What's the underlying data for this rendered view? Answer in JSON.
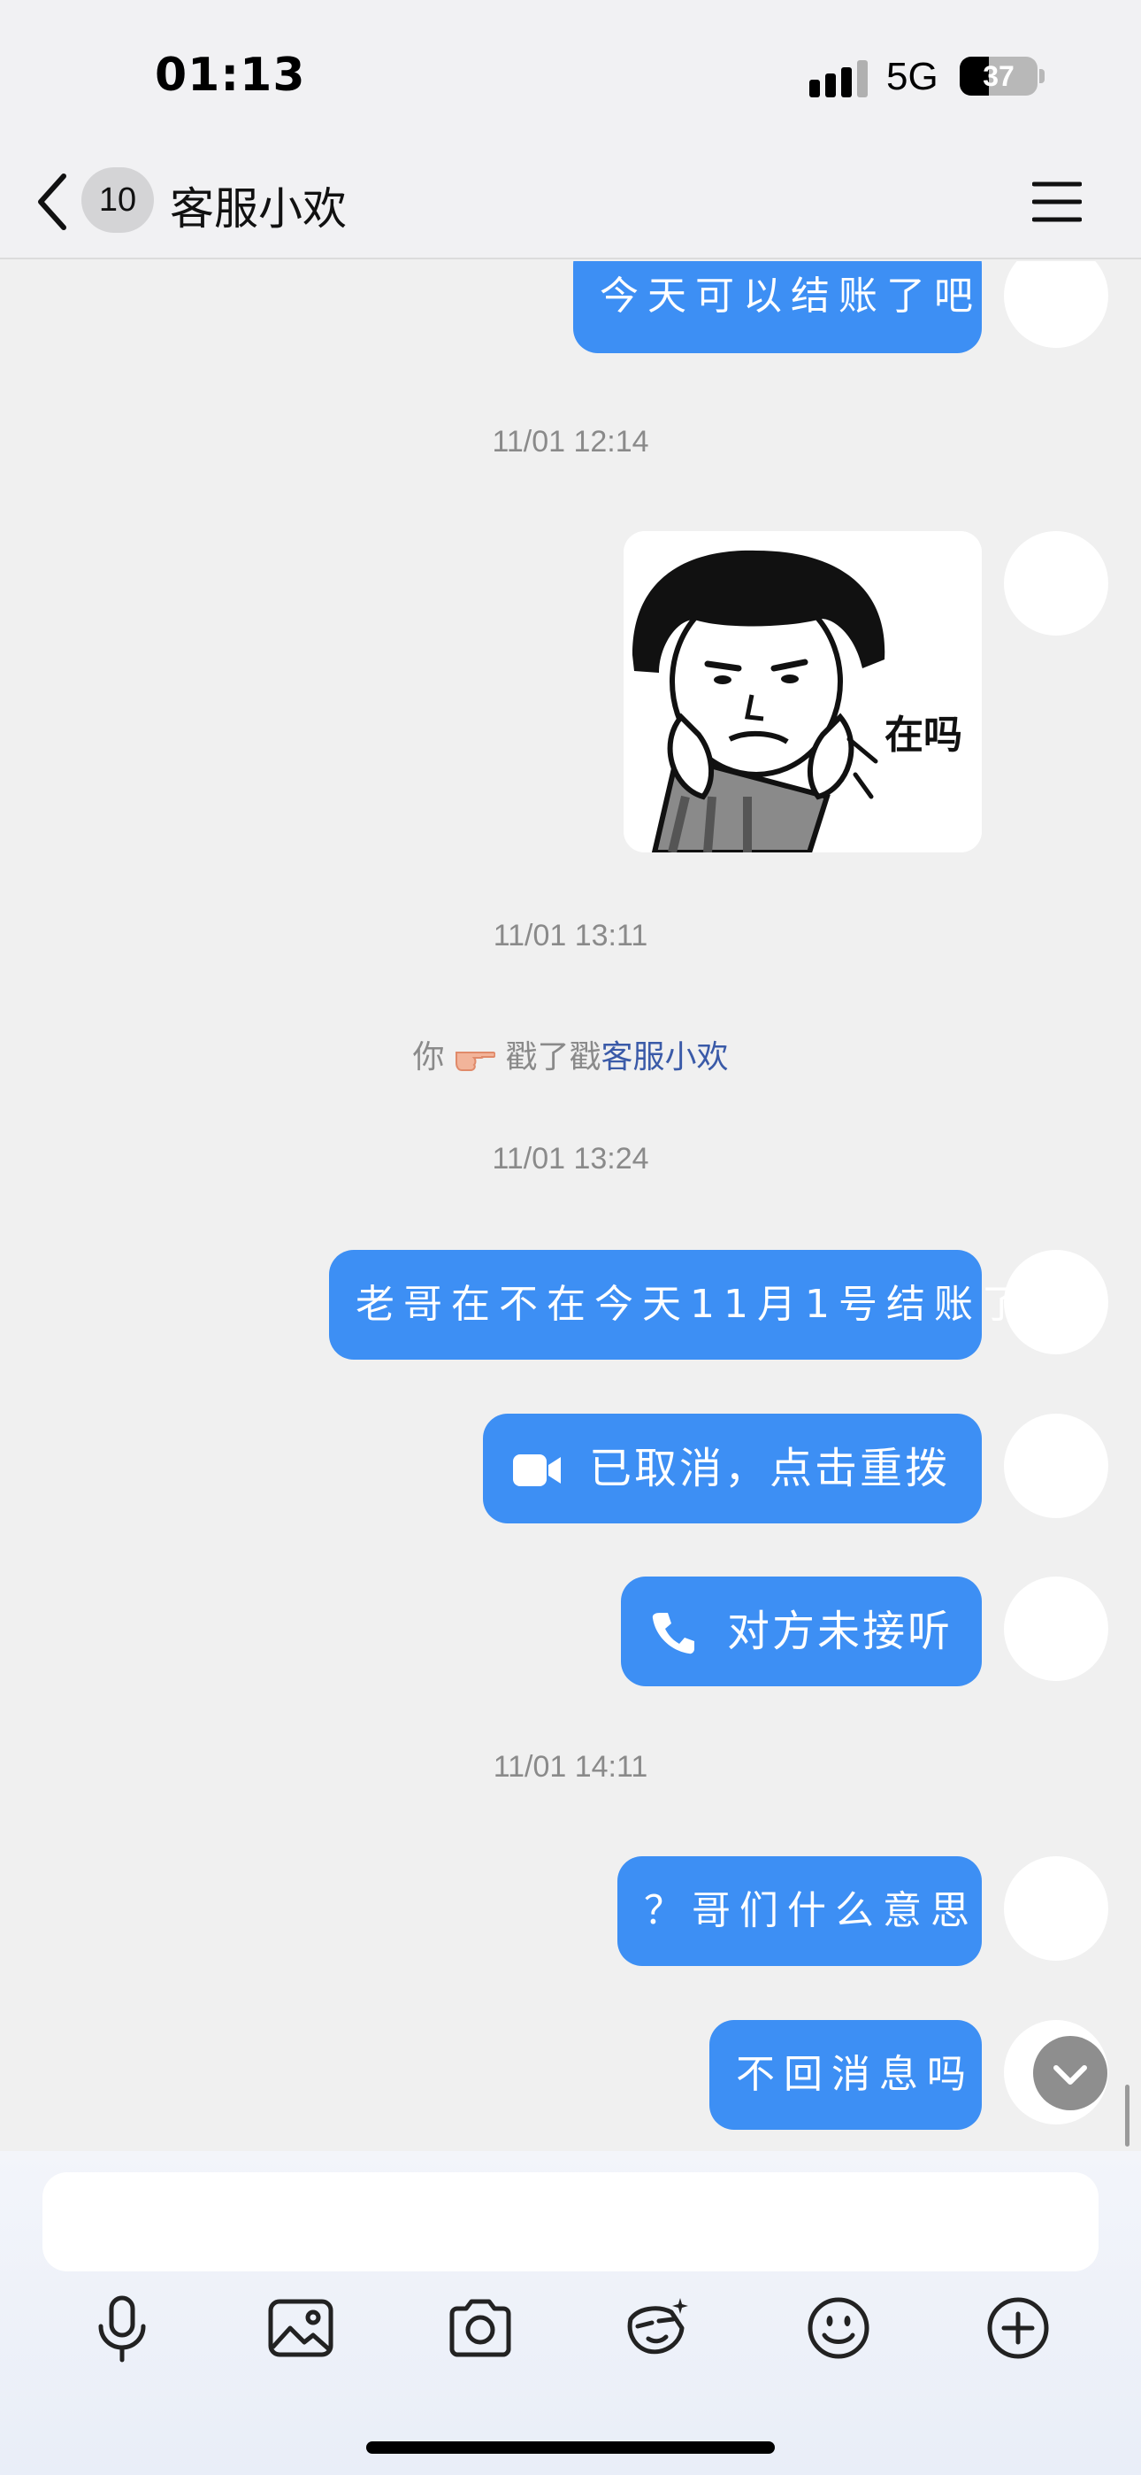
{
  "status_bar": {
    "time": "01:13",
    "network": "5G",
    "battery_level": "37"
  },
  "nav": {
    "unread_count": "10",
    "title": "客服小欢"
  },
  "messages": [
    {
      "type": "text",
      "text": "今天可以结账了吧"
    },
    {
      "type": "timestamp",
      "text": "11/01 12:14"
    },
    {
      "type": "sticker",
      "caption": "在吗"
    },
    {
      "type": "timestamp",
      "text": "11/01 13:11"
    },
    {
      "type": "poke",
      "actor": "你",
      "action": "戳了戳",
      "target": "客服小欢"
    },
    {
      "type": "timestamp",
      "text": "11/01 13:24"
    },
    {
      "type": "text",
      "text": "老哥在不在今天11月1号结账了"
    },
    {
      "type": "video-call",
      "icon": "video-camera-icon",
      "text": "已取消，点击重拨"
    },
    {
      "type": "voice-call",
      "icon": "phone-icon",
      "text": "对方未接听"
    },
    {
      "type": "timestamp",
      "text": "11/01 14:11"
    },
    {
      "type": "text",
      "text": "？哥们什么意思"
    },
    {
      "type": "text",
      "text": "不回消息吗"
    }
  ],
  "input": {
    "placeholder": ""
  },
  "toolbar": [
    "microphone-icon",
    "image-icon",
    "camera-icon",
    "ai-assistant-icon",
    "emoji-icon",
    "plus-icon"
  ],
  "colors": {
    "bubble": "#3d8ff4",
    "background": "#f0f0f0",
    "link": "#3a5aa8",
    "timestamp": "#8a8a8a"
  }
}
